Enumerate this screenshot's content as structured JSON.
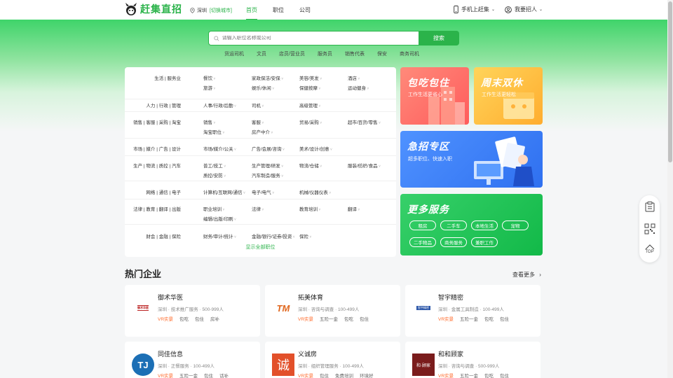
{
  "header": {
    "logo_text": "赶集直招",
    "city": "深圳",
    "switch_city": "[切换城市]",
    "nav": [
      "首页",
      "职位",
      "公司"
    ],
    "mobile": "手机上赶集",
    "recruit": "我要招人"
  },
  "search": {
    "placeholder": "请输入职位名称或公司",
    "button": "搜索",
    "hot_keywords": [
      "货运司机",
      "文员",
      "店员/营业员",
      "服务员",
      "销售代表",
      "保安",
      "商务司机"
    ]
  },
  "categories": [
    {
      "title": "生活 | 服务业",
      "items": [
        "餐饮",
        "家政保洁/安保",
        "美容/美发",
        "酒店",
        "旅游",
        "娱乐/休闲",
        "保健按摩",
        "运动健身"
      ]
    },
    {
      "title": "人力 | 行政 | 管理",
      "items": [
        "人事/行政/后勤",
        "司机",
        "高级管理"
      ]
    },
    {
      "title": "销售 | 客服 | 采购 | 淘宝",
      "items": [
        "销售",
        "客服",
        "贸易/采购",
        "超市/百货/零售",
        "淘宝职位",
        "房产中介"
      ]
    },
    {
      "title": "市场 | 媒介 | 广告 | 设计",
      "items": [
        "市场/媒介/公关",
        "广告/会展/咨询",
        "美术/设计/创意"
      ]
    },
    {
      "title": "生产 | 物流 | 质控 | 汽车",
      "items": [
        "普工/技工",
        "生产管理/研发",
        "物流/仓储",
        "服装/纺织/食品",
        "质控/安防",
        "汽车制造/服务"
      ]
    },
    {
      "title": "网络 | 通信 | 电子",
      "items": [
        "计算机/互联网/通信",
        "电子/电气",
        "机械/仪器仪表"
      ]
    },
    {
      "title": "法律 | 教育 | 翻译 | 出版",
      "items": [
        "职业培训",
        "法律",
        "教育培训",
        "翻译",
        "编辑/出版/印刷"
      ]
    },
    {
      "title": "财会 | 金融 | 保险",
      "items": [
        "财务/审计/统计",
        "金融/银行/证券/投资",
        "保险"
      ]
    }
  ],
  "show_all": "显示全部职位",
  "promos": {
    "baochi": {
      "title": "包吃包住",
      "sub": "工作生活更省心"
    },
    "zhoumo": {
      "title": "周末双休",
      "sub": "工作生活更轻松"
    },
    "jizhao": {
      "title": "急招专区",
      "sub": "超多职位、快速入职"
    },
    "more": {
      "title": "更多服务",
      "tags": [
        "租房",
        "二手车",
        "本地生活",
        "宠物",
        "二手物品",
        "商务服务",
        "兼职工作"
      ]
    }
  },
  "hot_companies": {
    "title": "热门企业",
    "more": "查看更多",
    "list": [
      {
        "name": "御术华医",
        "meta": "深圳 · 技术推广服务 · 500-999人",
        "tags": [
          "VR实景",
          "包吃",
          "包住",
          "房补"
        ],
        "logo": "御术华医"
      },
      {
        "name": "拓美体育",
        "meta": "深圳 · 咨询与调查 · 100-499人",
        "tags": [
          "VR实景",
          "五险一金",
          "包吃",
          "包住"
        ],
        "logo": "TM"
      },
      {
        "name": "智宇精密",
        "meta": "深圳 · 金属工具制造 · 100-499人",
        "tags": [
          "VR实景",
          "五险一金",
          "包吃",
          "包住"
        ],
        "logo": "智宇精密"
      },
      {
        "name": "同佳信息",
        "meta": "深圳 · 正餐服务 · 100-499人",
        "tags": [
          "VR实景",
          "五险一金",
          "包住",
          "话补"
        ],
        "logo": "TJ"
      },
      {
        "name": "义诚房",
        "meta": "深圳 · 组织管理服务 · 100-499人",
        "tags": [
          "VR实景",
          "包住",
          "免费培训",
          "环境好"
        ],
        "logo": "诚"
      },
      {
        "name": "和和顾家",
        "meta": "深圳 · 咨询与调查 · 500-999人",
        "tags": [
          "VR实景",
          "五险一金",
          "包吃",
          "包住"
        ],
        "logo": "和·顾家"
      }
    ]
  },
  "float": {
    "top": "TOP"
  },
  "colors": {
    "brand": "#2bb34a",
    "vr": "#ff6a2a"
  }
}
